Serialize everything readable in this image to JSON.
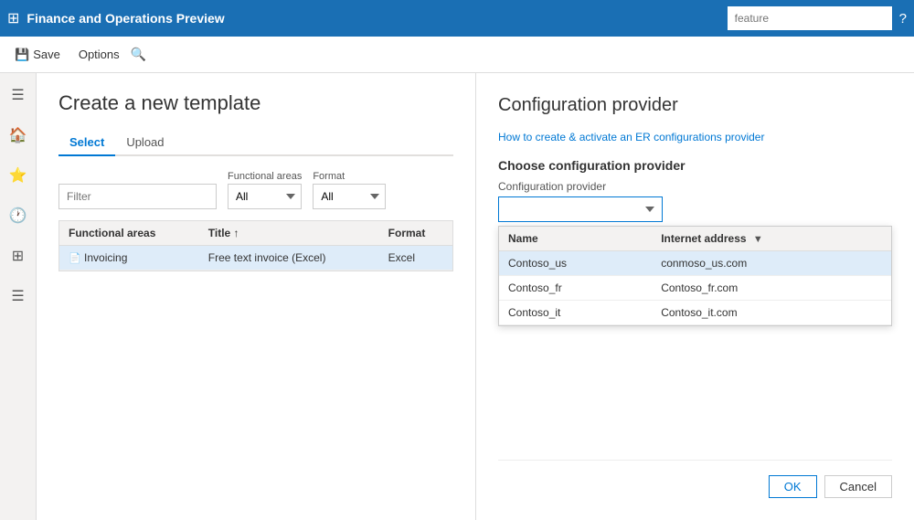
{
  "topbar": {
    "app_title": "Finance and Operations Preview",
    "search_placeholder": "feature",
    "grid_icon": "⊞",
    "help_icon": "?"
  },
  "toolbar": {
    "save_label": "Save",
    "options_label": "Options",
    "save_icon": "💾",
    "search_icon": "🔍"
  },
  "sidebar": {
    "icons": [
      "☰",
      "🏠",
      "⭐",
      "🕐",
      "⊞",
      "☰"
    ]
  },
  "content": {
    "page_title": "Create a new template",
    "tabs": [
      {
        "label": "Select",
        "active": true
      },
      {
        "label": "Upload",
        "active": false
      }
    ],
    "filter_placeholder": "Filter",
    "filter_functional_label": "Functional areas",
    "filter_functional_value": "All",
    "filter_format_label": "Format",
    "filter_format_value": "All",
    "table": {
      "columns": [
        "Functional areas",
        "Title ↑",
        "Format"
      ],
      "rows": [
        {
          "icon": "📄",
          "functional_area": "Invoicing",
          "title": "Free text invoice (Excel)",
          "format": "Excel",
          "selected": true
        }
      ]
    }
  },
  "panel": {
    "title": "Configuration provider",
    "link_text": "How to create & activate an ER configurations provider",
    "section_title": "Choose configuration provider",
    "config_label": "Configuration provider",
    "config_value": "",
    "dropdown": {
      "columns": [
        {
          "label": "Name",
          "filter": false
        },
        {
          "label": "Internet address",
          "filter": true
        }
      ],
      "rows": [
        {
          "name": "Contoso_us",
          "address": "conmoso_us.com",
          "selected": true
        },
        {
          "name": "Contoso_fr",
          "address": "Contoso_fr.com",
          "selected": false
        },
        {
          "name": "Contoso_it",
          "address": "Contoso_it.com",
          "selected": false
        }
      ]
    },
    "ok_label": "OK",
    "cancel_label": "Cancel"
  }
}
